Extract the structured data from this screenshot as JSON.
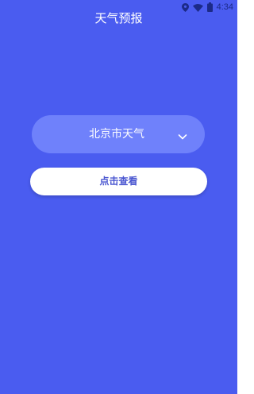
{
  "status_bar": {
    "time": "4:34",
    "icons": [
      "location-icon",
      "wifi-icon",
      "battery-icon"
    ]
  },
  "header": {
    "title": "天气预报"
  },
  "city_selector": {
    "selected": "北京市天气",
    "icon": "chevron-down-icon"
  },
  "action": {
    "view_label": "点击查看"
  },
  "colors": {
    "background": "#4a5cf0",
    "selector_bg": "#6f81fb",
    "button_bg": "#ffffff",
    "button_text": "#4a56d0",
    "status_icons": "#1c2a88"
  }
}
